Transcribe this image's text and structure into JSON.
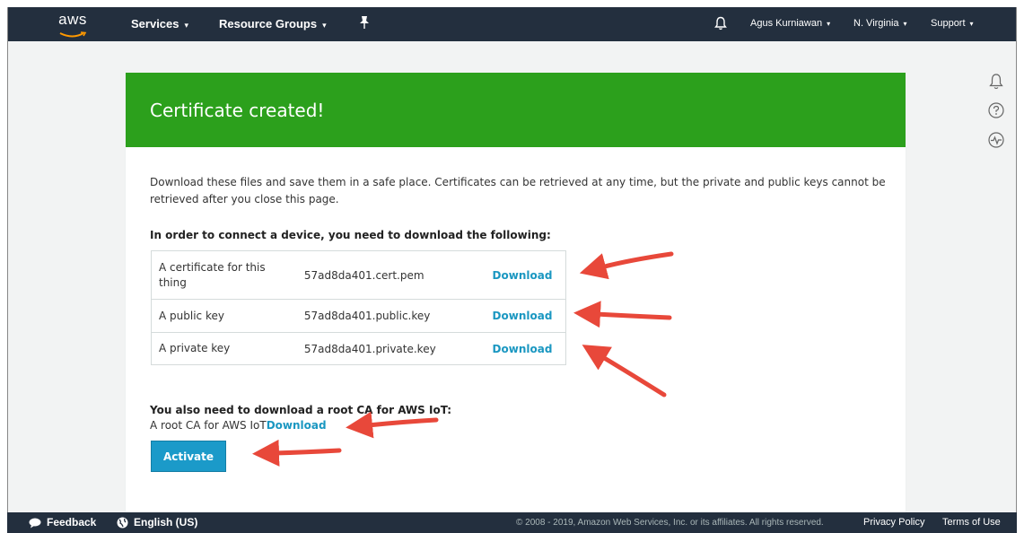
{
  "topnav": {
    "logo_text": "aws",
    "services": "Services",
    "resource_groups": "Resource Groups",
    "user": "Agus Kurniawan",
    "region": "N. Virginia",
    "support": "Support",
    "caret": "▾"
  },
  "icons": {
    "pin": "pin-icon",
    "bell": "bell-icon",
    "help": "help-icon",
    "activity": "activity-icon"
  },
  "banner": {
    "title": "Certificate created!"
  },
  "description": "Download these files and save them in a safe place. Certificates can be retrieved at any time, but the private and public keys cannot be retrieved after you close this page.",
  "files_heading": "In order to connect a device, you need to download the following:",
  "files": [
    {
      "label": "A certificate for this thing",
      "file": "57ad8da401.cert.pem",
      "action": "Download"
    },
    {
      "label": "A public key",
      "file": "57ad8da401.public.key",
      "action": "Download"
    },
    {
      "label": "A private key",
      "file": "57ad8da401.private.key",
      "action": "Download"
    }
  ],
  "root_ca": {
    "heading": "You also need to download a root CA for AWS IoT:",
    "label": "A root CA for AWS IoT",
    "action": "Download"
  },
  "activate_label": "Activate",
  "footer": {
    "feedback": "Feedback",
    "language": "English (US)",
    "copyright": "© 2008 - 2019, Amazon Web Services, Inc. or its affiliates. All rights reserved.",
    "privacy": "Privacy Policy",
    "terms": "Terms of Use"
  },
  "colors": {
    "nav_bg": "#232f3e",
    "banner_green": "#2ca01c",
    "link_blue": "#1a97c1",
    "button_blue": "#1b9ac9",
    "arrow_red": "#e8483a"
  }
}
